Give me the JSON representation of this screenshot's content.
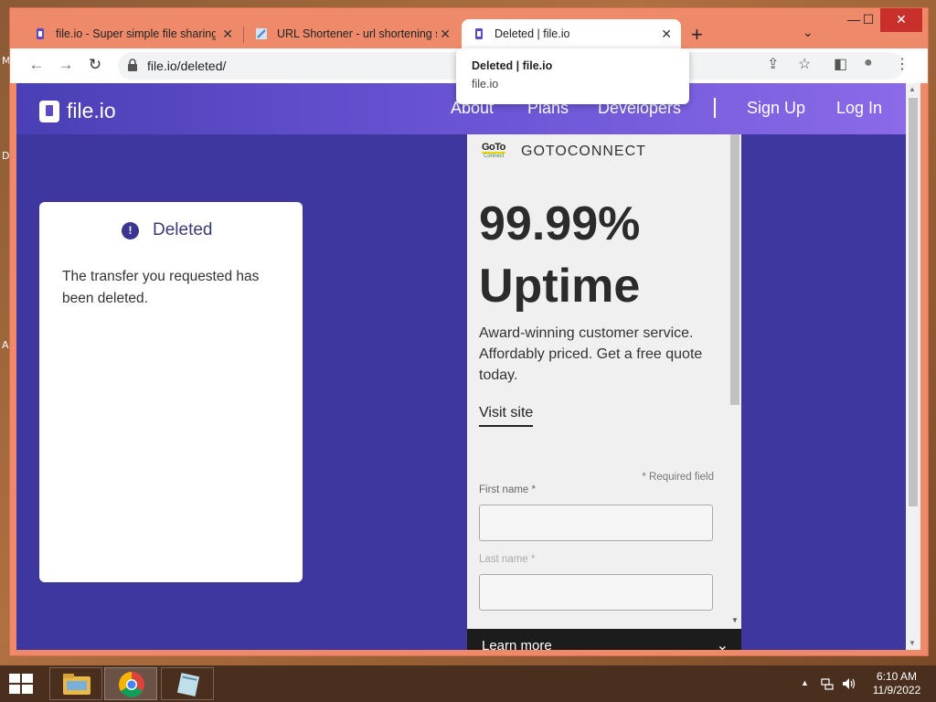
{
  "desktop": {
    "edge_letters": [
      "M",
      "D",
      "A"
    ]
  },
  "browser": {
    "tabs": [
      {
        "title": "file.io - Super simple file sharing",
        "icon": "fileio-favicon",
        "active": false
      },
      {
        "title": "URL Shortener - url shortening s",
        "icon": "url-shortener-favicon",
        "active": false
      },
      {
        "title": "Deleted | file.io",
        "icon": "fileio-favicon",
        "active": true
      }
    ],
    "tab_close_glyph": "✕",
    "new_tab_glyph": "+",
    "tab_search_glyph": "⌄",
    "window_controls": {
      "minimize": "—",
      "maximize": "☐",
      "close": "✕"
    },
    "nav": {
      "back": "←",
      "forward": "→",
      "reload": "↻"
    },
    "address": "file.io/deleted/",
    "toolbar_right": {
      "share": "⇪",
      "bookmark": "☆",
      "sidepanel": "◧",
      "profile": "●",
      "menu": "⋮"
    },
    "tooltip": {
      "title": "Deleted | file.io",
      "subtitle": "file.io"
    }
  },
  "site": {
    "logo_text": "file.io",
    "nav": {
      "about": "About",
      "plans": "Plans",
      "developers": "Developers",
      "signup": "Sign Up",
      "login": "Log In"
    },
    "card": {
      "icon_glyph": "!",
      "title": "Deleted",
      "message": "The transfer you requested has been deleted."
    }
  },
  "ad": {
    "logo_top": "GoTo",
    "logo_bottom": "Connect",
    "brand": "GOTOCONNECT",
    "headline_line1": "99.99%",
    "headline_line2": "Uptime",
    "body": "Award-winning customer service. Affordably priced. Get a free quote today.",
    "cta": "Visit site",
    "required_note": "* Required field",
    "first_name_label": "First name *",
    "last_name_label": "Last name *",
    "bottom_bar_label": "Learn more",
    "bottom_bar_chevron": "⌄"
  },
  "taskbar": {
    "tray_arrow": "▲",
    "time": "6:10 AM",
    "date": "11/9/2022"
  },
  "colors": {
    "window_frame": "#ee8a6a",
    "page_background": "#3e37a0",
    "header_gradient_start": "#4a3fb5",
    "header_gradient_end": "#8a6ae8",
    "taskbar": "#4a2e1e"
  }
}
